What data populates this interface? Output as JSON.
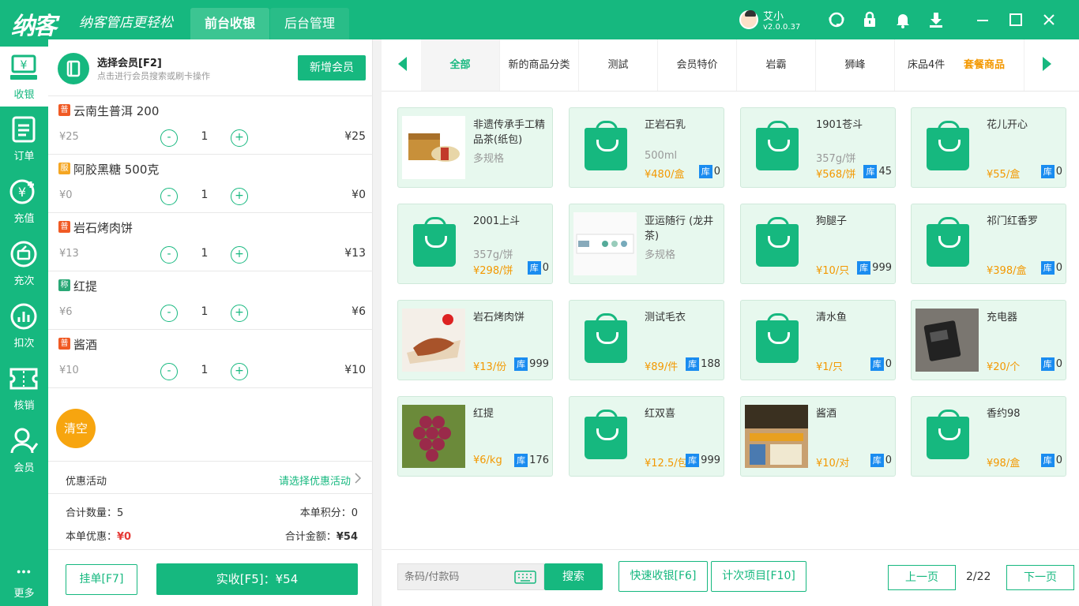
{
  "app": {
    "logo": "纳客",
    "slogan": "纳客管店更轻松",
    "tabs": [
      {
        "label": "前台收银"
      },
      {
        "label": "后台管理"
      }
    ],
    "user": {
      "name": "艾小",
      "version": "v2.0.0.37"
    }
  },
  "sidebar": {
    "items": [
      {
        "label": "收银",
        "icon": "cash-register-icon"
      },
      {
        "label": "订单",
        "icon": "order-list-icon"
      },
      {
        "label": "充值",
        "icon": "recharge-icon"
      },
      {
        "label": "充次",
        "icon": "recharge-count-icon"
      },
      {
        "label": "扣次",
        "icon": "deduct-count-icon"
      },
      {
        "label": "核销",
        "icon": "ticket-icon"
      },
      {
        "label": "会员",
        "icon": "member-icon"
      },
      {
        "label": "更多",
        "icon": "more-icon"
      }
    ]
  },
  "member": {
    "title": "选择会员[F2]",
    "subtitle": "点击进行会员搜索或刷卡操作",
    "add_label": "新增会员"
  },
  "cart": {
    "items": [
      {
        "tag": "普",
        "tag_color": "#f05a24",
        "name": "云南生普洱 200",
        "price": "¥25",
        "qty": "1",
        "total": "¥25"
      },
      {
        "tag": "服",
        "tag_color": "#f5a623",
        "name": "阿胶黑糖 500克",
        "price": "¥0",
        "qty": "1",
        "total": "¥0"
      },
      {
        "tag": "普",
        "tag_color": "#f05a24",
        "name": "岩石烤肉饼",
        "price": "¥13",
        "qty": "1",
        "total": "¥13"
      },
      {
        "tag": "称",
        "tag_color": "#2aa876",
        "name": "红提",
        "price": "¥6",
        "qty": "1",
        "total": "¥6"
      },
      {
        "tag": "普",
        "tag_color": "#f05a24",
        "name": "酱酒",
        "price": "¥10",
        "qty": "1",
        "total": "¥10"
      }
    ],
    "clear_label": "清空"
  },
  "promo": {
    "label": "优惠活动",
    "value": "请选择优惠活动"
  },
  "summary": {
    "qty_label": "合计数量：",
    "qty": "5",
    "points_label": "本单积分：",
    "points": "0",
    "discount_label": "本单优惠：",
    "discount": "¥0",
    "total_label": "合计金额：",
    "total": "¥54"
  },
  "actions": {
    "hold_label": "挂单[F7]",
    "pay_label": "实收[F5]：¥54"
  },
  "categories": [
    {
      "label": "全部",
      "active": true
    },
    {
      "label": "新的商品分类"
    },
    {
      "label": "测試"
    },
    {
      "label": "会员特价"
    },
    {
      "label": "岩霸"
    },
    {
      "label": "狮峰"
    },
    {
      "label": "床品4件"
    },
    {
      "label": "套餐商品",
      "highlight": true
    }
  ],
  "products": [
    {
      "name": "非遗传承手工精品茶(纸包)",
      "spec": "多规格",
      "price": "",
      "stock": "",
      "img": "tea"
    },
    {
      "name": "正岩石乳",
      "spec": "500ml",
      "price": "¥480/盒",
      "stock": "0",
      "img": "bag"
    },
    {
      "name": "1901苍斗",
      "spec": "357g/饼",
      "price": "¥568/饼",
      "stock": "45",
      "img": "bag"
    },
    {
      "name": "花儿开心",
      "spec": "",
      "price": "¥55/盒",
      "stock": "0",
      "img": "bag"
    },
    {
      "name": "2001上斗",
      "spec": "357g/饼",
      "price": "¥298/饼",
      "stock": "0",
      "img": "bag"
    },
    {
      "name": "亚运随行 (龙井茶)",
      "spec": "多规格",
      "price": "",
      "stock": "",
      "img": "box"
    },
    {
      "name": "狗腿子",
      "spec": "",
      "price": "¥10/只",
      "stock": "999",
      "img": "bag"
    },
    {
      "name": "祁门红香罗",
      "spec": "",
      "price": "¥398/盒",
      "stock": "0",
      "img": "bag"
    },
    {
      "name": "岩石烤肉饼",
      "spec": "",
      "price": "¥13/份",
      "stock": "999",
      "img": "food"
    },
    {
      "name": "测试毛衣",
      "spec": "",
      "price": "¥89/件",
      "stock": "188",
      "img": "bag"
    },
    {
      "name": "清水鱼",
      "spec": "",
      "price": "¥1/只",
      "stock": "0",
      "img": "bag"
    },
    {
      "name": "充电器",
      "spec": "",
      "price": "¥20/个",
      "stock": "0",
      "img": "charger"
    },
    {
      "name": "红提",
      "spec": "",
      "price": "¥6/kg",
      "stock": "176",
      "img": "grape"
    },
    {
      "name": "红双喜",
      "spec": "",
      "price": "¥12.5/包",
      "stock": "999",
      "img": "bag"
    },
    {
      "name": "酱酒",
      "spec": "",
      "price": "¥10/对",
      "stock": "0",
      "img": "store"
    },
    {
      "name": "香约98",
      "spec": "",
      "price": "¥98/盒",
      "stock": "0",
      "img": "bag"
    }
  ],
  "stock_label": "库",
  "bottom": {
    "search_placeholder": "条码/付款码",
    "search_label": "搜索",
    "quick_label": "快速收银[F6]",
    "count_label": "计次项目[F10]",
    "prev_label": "上一页",
    "next_label": "下一页",
    "page": "2/22"
  },
  "colors": {
    "primary": "#16b87f",
    "price": "#f39800",
    "stock_badge": "#1a8cf0",
    "discount": "#e53935"
  }
}
